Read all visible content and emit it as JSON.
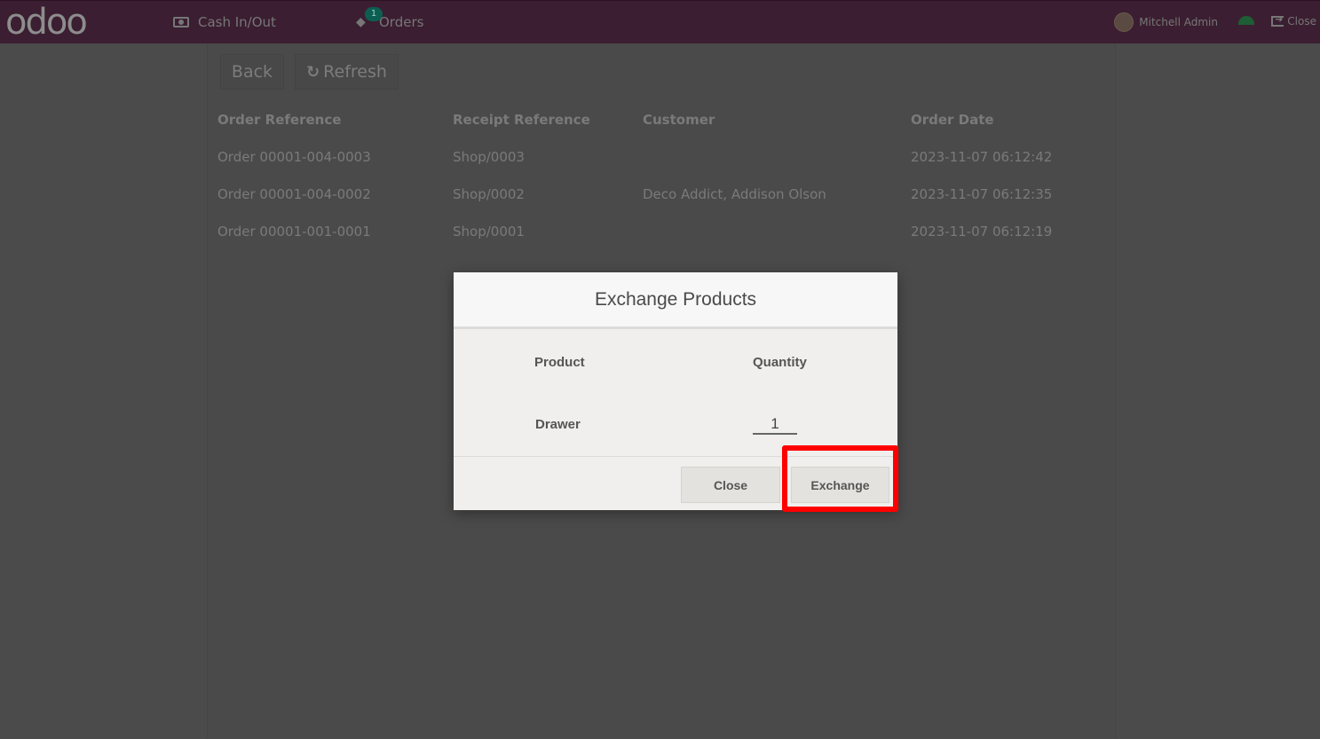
{
  "topbar": {
    "logo": "odoo",
    "cash_label": "Cash In/Out",
    "orders_label": "Orders",
    "orders_badge": "1",
    "user_name": "Mitchell Admin",
    "close_label": "Close"
  },
  "toolbar": {
    "back_label": "Back",
    "refresh_label": "Refresh"
  },
  "orders_table": {
    "headers": [
      "Order Reference",
      "Receipt Reference",
      "Customer",
      "Order Date"
    ],
    "rows": [
      {
        "order_ref": "Order 00001-004-0003",
        "receipt_ref": "Shop/0003",
        "customer": "",
        "date": "2023-11-07 06:12:42"
      },
      {
        "order_ref": "Order 00001-004-0002",
        "receipt_ref": "Shop/0002",
        "customer": "Deco Addict, Addison Olson",
        "date": "2023-11-07 06:12:35"
      },
      {
        "order_ref": "Order 00001-001-0001",
        "receipt_ref": "Shop/0001",
        "customer": "",
        "date": "2023-11-07 06:12:19"
      }
    ]
  },
  "modal": {
    "title": "Exchange Products",
    "col_product": "Product",
    "col_quantity": "Quantity",
    "product_name": "Drawer",
    "quantity_value": "1",
    "close_label": "Close",
    "exchange_label": "Exchange"
  },
  "colors": {
    "topbar": "#3b1e31",
    "highlight": "#ff0000",
    "overlay": "#4b4b4b"
  }
}
